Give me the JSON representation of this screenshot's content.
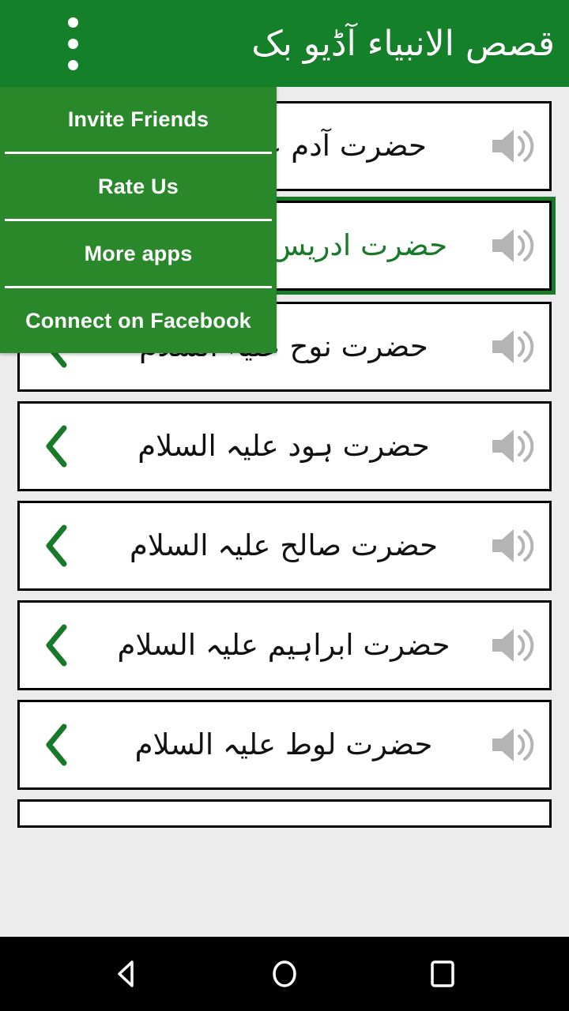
{
  "appbar": {
    "title": "قصص الانبیاء آڈیو بک",
    "overflow_icon": "overflow-menu-icon"
  },
  "menu": {
    "open": true,
    "items": [
      {
        "label": "Invite Friends"
      },
      {
        "label": "Rate Us"
      },
      {
        "label": "More apps"
      },
      {
        "label": "Connect on Facebook"
      }
    ]
  },
  "list": {
    "speaker_icon": "speaker-icon",
    "chevron_icon": "chevron-left-icon",
    "items": [
      {
        "title": "حضرت آدم علیہ السلام",
        "selected": false
      },
      {
        "title": "حضرت ادریس علیہ السلام",
        "selected": true
      },
      {
        "title": "حضرت نوح علیہ السلام",
        "selected": false
      },
      {
        "title": "حضرت ہود علیہ السلام",
        "selected": false
      },
      {
        "title": "حضرت صالح علیہ السلام",
        "selected": false
      },
      {
        "title": "حضرت ابراہیم علیہ السلام",
        "selected": false
      },
      {
        "title": "حضرت لوط علیہ السلام",
        "selected": false
      }
    ]
  },
  "navbar": {
    "back": "back-icon",
    "home": "home-icon",
    "recents": "recents-icon"
  },
  "colors": {
    "appbar_green": "#15802a",
    "menu_green": "#28882a",
    "accent_green": "#187a29",
    "list_background": "#ececec",
    "row_border": "#000000",
    "speaker_gray": "#b4b4b4",
    "navbar_black": "#000000"
  }
}
